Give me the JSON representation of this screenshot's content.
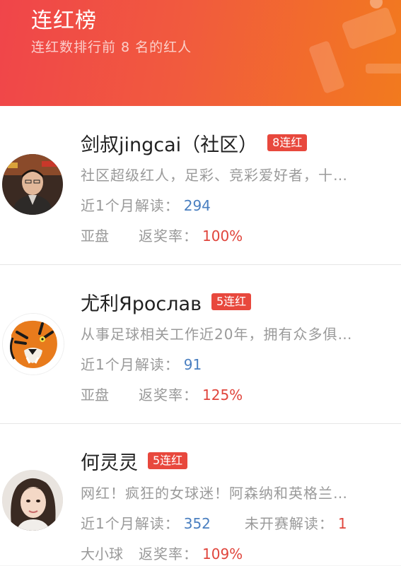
{
  "header": {
    "title": "连红榜",
    "subtitle": "连红数排行前 8 名的红人"
  },
  "colors": {
    "accent_red": "#e8483d",
    "link_blue": "#4a7fc0"
  },
  "experts": [
    {
      "name": "剑叔jingcai（社区）",
      "badge": "8连红",
      "desc": "社区超级红人，足彩、竞彩爱好者，十…",
      "monthly_label": "近1个月解读：",
      "monthly_value": "294",
      "play_type": "亚盘",
      "return_label": "返奖率：",
      "return_value": "100%",
      "avatar_icon": "man-photo-avatar"
    },
    {
      "name": "尤利Ярослав",
      "badge": "5连红",
      "desc": "从事足球相关工作近20年，拥有众多俱…",
      "monthly_label": "近1个月解读：",
      "monthly_value": "91",
      "play_type": "亚盘",
      "return_label": "返奖率：",
      "return_value": "125%",
      "avatar_icon": "tiger-avatar"
    },
    {
      "name": "何灵灵",
      "badge": "5连红",
      "desc": "网红！疯狂的女球迷！阿森纳和英格兰…",
      "monthly_label": "近1个月解读：",
      "monthly_value": "352",
      "pending_label": "未开赛解读：",
      "pending_value": "1",
      "play_type": "大小球",
      "return_label": "返奖率：",
      "return_value": "109%",
      "avatar_icon": "woman-photo-avatar"
    }
  ]
}
